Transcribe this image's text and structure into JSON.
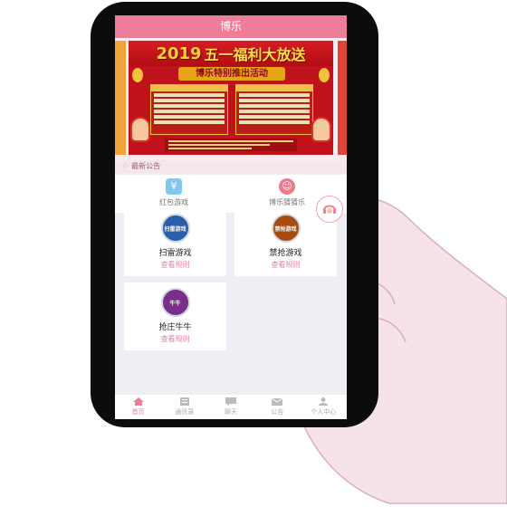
{
  "header": {
    "title": "博乐"
  },
  "banner": {
    "year": "2019",
    "headline": "五一福利大放送",
    "subtitle": "博乐特别推出活动"
  },
  "notice": {
    "label": "最新公告",
    "icon": "bell-icon"
  },
  "quick_actions": [
    {
      "label": "红包游戏",
      "icon": "yen-wallet-icon",
      "color": "#7fc7ee"
    },
    {
      "label": "博乐猜猜乐",
      "icon": "smiley-icon",
      "color": "#f07a8d"
    }
  ],
  "games": [
    {
      "title": "扫雷游戏",
      "rules": "查看规则",
      "badge": "扫雷游戏",
      "color": "#2b5ea8"
    },
    {
      "title": "禁抢游戏",
      "rules": "查看规则",
      "badge": "禁抢游戏",
      "color": "#a84d10"
    },
    {
      "title": "抢庄牛牛",
      "rules": "查看规则",
      "badge": "牛牛",
      "color": "#7a2f8a"
    }
  ],
  "tabs": [
    {
      "label": "首页",
      "icon": "home-icon",
      "active": true
    },
    {
      "label": "通讯录",
      "icon": "contacts-icon",
      "active": false
    },
    {
      "label": "聊天",
      "icon": "chat-icon",
      "active": false
    },
    {
      "label": "公告",
      "icon": "mail-icon",
      "active": false
    },
    {
      "label": "个人中心",
      "icon": "user-icon",
      "active": false
    }
  ],
  "colors": {
    "accent": "#ef7c98",
    "banner_red": "#c0121b",
    "banner_gold": "#ffd23a"
  }
}
